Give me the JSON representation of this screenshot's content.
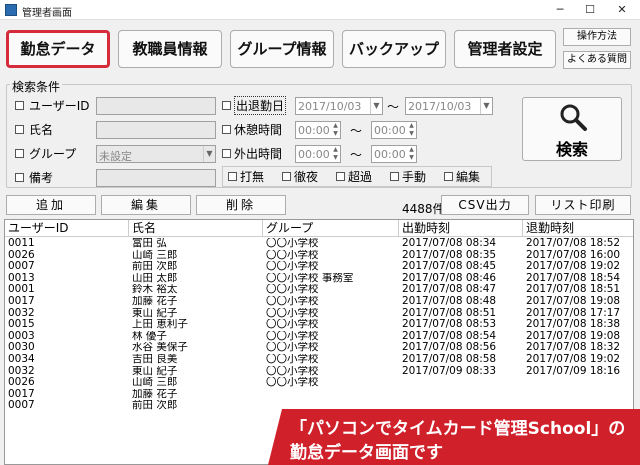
{
  "window": {
    "title": "管理者画面",
    "controls": [
      "─",
      "☐",
      "✕"
    ]
  },
  "nav": {
    "kintai": "勤怠データ",
    "staff": "教職員情報",
    "group": "グループ情報",
    "backup": "バックアップ",
    "admin": "管理者設定",
    "howto": "操作方法",
    "faq": "よくある質問"
  },
  "search": {
    "legend": "検索条件",
    "user_id_label": "ユーザーID",
    "name_label": "氏名",
    "group_label": "グループ",
    "group_value": "未設定",
    "remarks_label": "備考",
    "date_label": "出退勤日",
    "date_from": "2017/10/03",
    "date_to": "2017/10/03",
    "tilde": "〜",
    "break_label": "休憩時間",
    "out_label": "外出時間",
    "time_placeholder": "00:00",
    "flags": [
      "打無",
      "徹夜",
      "超過",
      "手動",
      "編集"
    ],
    "search_button": "検索"
  },
  "actions": {
    "add": "追加",
    "edit": "編集",
    "delete": "削除",
    "count": "4488件",
    "csv": "CSV出力",
    "print": "リスト印刷"
  },
  "table": {
    "columns": [
      "ユーザーID",
      "氏名",
      "グループ",
      "出勤時刻",
      "退勤時刻"
    ],
    "rows": [
      [
        "0011",
        "富田 弘",
        "〇〇小学校",
        "2017/07/08 08:34",
        "2017/07/08 18:52"
      ],
      [
        "0026",
        "山崎 三郎",
        "〇〇小学校",
        "2017/07/08 08:35",
        "2017/07/08 16:00"
      ],
      [
        "0007",
        "前田 次郎",
        "〇〇小学校",
        "2017/07/08 08:45",
        "2017/07/08 19:02"
      ],
      [
        "0013",
        "山田 太郎",
        "〇〇小学校 事務室",
        "2017/07/08 08:46",
        "2017/07/08 18:54"
      ],
      [
        "0001",
        "鈴木 裕太",
        "〇〇小学校",
        "2017/07/08 08:47",
        "2017/07/08 18:51"
      ],
      [
        "0017",
        "加藤 花子",
        "〇〇小学校",
        "2017/07/08 08:48",
        "2017/07/08 19:08"
      ],
      [
        "0032",
        "東山 紀子",
        "〇〇小学校",
        "2017/07/08 08:51",
        "2017/07/08 17:17"
      ],
      [
        "0015",
        "上田 恵利子",
        "〇〇小学校",
        "2017/07/08 08:53",
        "2017/07/08 18:38"
      ],
      [
        "0003",
        "林 優子",
        "〇〇小学校",
        "2017/07/08 08:54",
        "2017/07/08 19:08"
      ],
      [
        "0030",
        "水谷 美保子",
        "〇〇小学校",
        "2017/07/08 08:56",
        "2017/07/08 18:32"
      ],
      [
        "0034",
        "吉田 良美",
        "〇〇小学校",
        "2017/07/08 08:58",
        "2017/07/08 19:02"
      ],
      [
        "0032",
        "東山 紀子",
        "〇〇小学校",
        "2017/07/09 08:33",
        "2017/07/09 18:16"
      ],
      [
        "0026",
        "山崎 三郎",
        "〇〇小学校",
        "",
        ""
      ],
      [
        "0017",
        "加藤 花子",
        "",
        "",
        ""
      ],
      [
        "0007",
        "前田 次郎",
        "",
        "",
        ""
      ]
    ]
  },
  "banner": {
    "line1": "「パソコンでタイムカード管理School」の",
    "line2": "勤怠データ画面です"
  },
  "colors": {
    "active_border": "#d52b3a",
    "banner": "#d0202a"
  }
}
